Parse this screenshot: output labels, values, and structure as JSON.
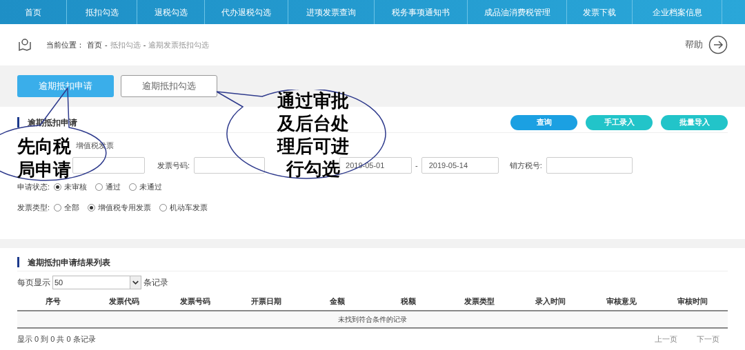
{
  "nav": {
    "items": [
      "首页",
      "抵扣勾选",
      "退税勾选",
      "代办退税勾选",
      "进项发票查询",
      "税务事项通知书",
      "成品油消费税管理",
      "发票下载",
      "企业档案信息"
    ]
  },
  "breadcrumb": {
    "label": "当前位置：",
    "items": [
      "首页",
      "抵扣勾选",
      "逾期发票抵扣勾选"
    ],
    "separator": "-"
  },
  "help": "帮助",
  "tabs": [
    {
      "label": "逾期抵扣申请",
      "selected": true
    },
    {
      "label": "逾期抵扣勾选",
      "selected": false
    }
  ],
  "form": {
    "title": "逾期抵扣申请",
    "buttons": [
      {
        "label": "查询",
        "kind": "primary"
      },
      {
        "label": "手工录入",
        "kind": "secondary"
      },
      {
        "label": "批量导入",
        "kind": "secondary"
      }
    ],
    "row1_option": "增值税发票",
    "invoice_number_label": "发票号码:",
    "date_from": "2019-05-01",
    "date_sep": "-",
    "date_to": "2019-05-14",
    "seller_tax_label": "销方税号:",
    "status": {
      "label": "申请状态:",
      "options": [
        {
          "label": "未审核",
          "selected": true
        },
        {
          "label": "通过",
          "selected": false
        },
        {
          "label": "未通过",
          "selected": false
        }
      ]
    },
    "type": {
      "label": "发票类型:",
      "options": [
        {
          "label": "全部",
          "selected": false
        },
        {
          "label": "增值税专用发票",
          "selected": true
        },
        {
          "label": "机动车发票",
          "selected": false
        }
      ]
    }
  },
  "results": {
    "title": "逾期抵扣申请结果列表",
    "page_size_label": "每页显示",
    "page_size": "50",
    "page_size_suffix": "条记录",
    "columns": [
      "序号",
      "发票代码",
      "发票号码",
      "开票日期",
      "金额",
      "税额",
      "发票类型",
      "录入时间",
      "审核意见",
      "审核时间"
    ],
    "empty": "未找到符合条件的记录",
    "summary": "显示 0 到 0 共 0 条记录",
    "prev": "上一页",
    "next": "下一页"
  },
  "annotations": [
    {
      "lines": [
        "先向税",
        "局申请"
      ]
    },
    {
      "lines": [
        "通过审批",
        "及后台处",
        "理后可进",
        "行勾选"
      ]
    }
  ]
}
